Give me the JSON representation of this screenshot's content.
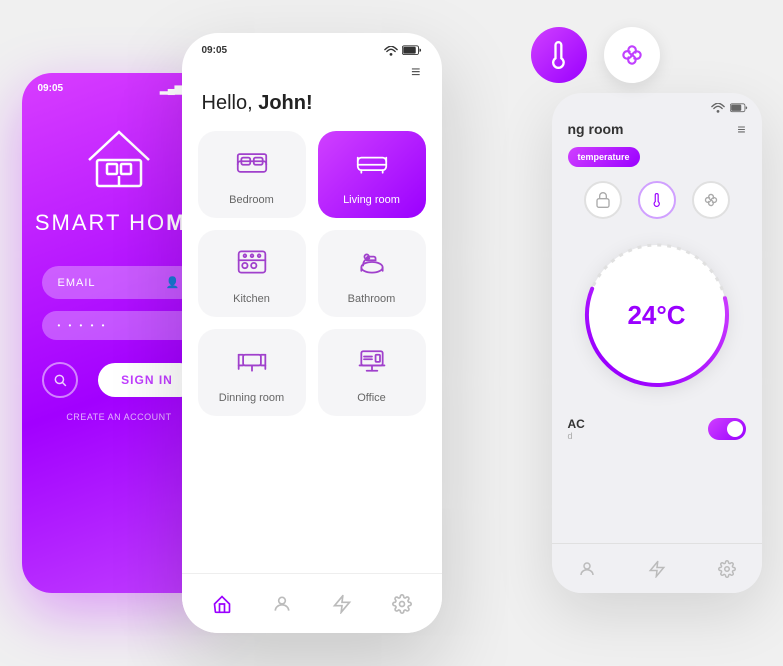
{
  "floating": {
    "thermometer_label": "thermometer",
    "fan_label": "fan"
  },
  "phone_left": {
    "time": "09:05",
    "brand_prefix": "SMART HO",
    "brand_suffix": "ME",
    "email_placeholder": "EMAIL",
    "password_dots": "• • • • •",
    "sign_in": "SIGN IN",
    "create_account": "CREATE AN ACCOUNT"
  },
  "phone_center": {
    "time": "09:05",
    "menu_icon": "≡",
    "greeting": "Hello, ",
    "name": "John!",
    "rooms": [
      {
        "id": "bedroom",
        "label": "Bedroom",
        "active": false
      },
      {
        "id": "living-room",
        "label": "Living room",
        "active": true
      },
      {
        "id": "kitchen",
        "label": "Kitchen",
        "active": false
      },
      {
        "id": "bathroom",
        "label": "Bathroom",
        "active": false
      },
      {
        "id": "dinning-room",
        "label": "Dinning room",
        "active": false
      },
      {
        "id": "office",
        "label": "Office",
        "active": false
      }
    ],
    "nav": [
      "home",
      "person",
      "bolt",
      "settings"
    ]
  },
  "phone_right": {
    "room_title": "ng room",
    "tab_temperature": "temperature",
    "temp_value": "24°C",
    "ac_label": "AC",
    "ac_sub": "d",
    "toggle_on": true
  }
}
